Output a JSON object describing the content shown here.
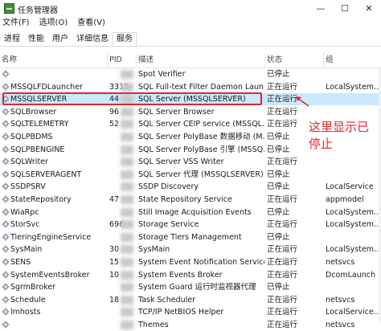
{
  "window": {
    "title": "任务管理器",
    "minimize_label": "—",
    "maximize_label": "☐",
    "close_label": "✕"
  },
  "menu": [
    "文件(F)",
    "选项(O)",
    "查看(V)"
  ],
  "tabs": [
    "进程",
    "性能",
    "用户",
    "详细信息",
    "服务"
  ],
  "active_tab_index": 4,
  "columns": {
    "name": "名称",
    "pid": "PID",
    "desc": "描述",
    "status": "状态",
    "group": "组"
  },
  "services": [
    {
      "name": "",
      "pid": "",
      "desc": "Spot Verifier",
      "status": "已停止",
      "group": ""
    },
    {
      "name": "MSSQLFDLauncher",
      "pid": "3312",
      "desc": "SQL Full-text Filter Daemon Laun...",
      "status": "正在运行",
      "group": "LocalSystem..."
    },
    {
      "name": "MSSQLSERVER",
      "pid": "44",
      "desc": "SQL Server (MSSQLSERVER)",
      "status": "正在运行",
      "group": ""
    },
    {
      "name": "SQLBrowser",
      "pid": "96",
      "desc": "SQL Server Browser",
      "status": "正在运行",
      "group": ""
    },
    {
      "name": "SQLTELEMETRY",
      "pid": "52",
      "desc": "SQL Server CEIP service (MSSQL...",
      "status": "正在运行",
      "group": ""
    },
    {
      "name": "SQLPBDMS",
      "pid": "",
      "desc": "SQL Server PolyBase 数据移动 (M...",
      "status": "已停止",
      "group": ""
    },
    {
      "name": "SQLPBENGINE",
      "pid": "",
      "desc": "SQL Server PolyBase 引擎 (MSSQ...",
      "status": "已停止",
      "group": ""
    },
    {
      "name": "SQLWriter",
      "pid": "",
      "desc": "SQL Server VSS Writer",
      "status": "正在运行",
      "group": ""
    },
    {
      "name": "SQLSERVERAGENT",
      "pid": "",
      "desc": "SQL Server 代理 (MSSQLSERVER)",
      "status": "已停止",
      "group": ""
    },
    {
      "name": "SSDPSRV",
      "pid": "",
      "desc": "SSDP Discovery",
      "status": "已停止",
      "group": "LocalService"
    },
    {
      "name": "StateRepository",
      "pid": "47",
      "desc": "State Repository Service",
      "status": "正在运行",
      "group": "appmodel"
    },
    {
      "name": "WiaRpc",
      "pid": "",
      "desc": "Still Image Acquisition Events",
      "status": "已停止",
      "group": "LocalSystem..."
    },
    {
      "name": "StorSvc",
      "pid": "696",
      "desc": "Storage Service",
      "status": "正在运行",
      "group": "LocalSystem..."
    },
    {
      "name": "TieringEngineService",
      "pid": "",
      "desc": "Storage Tiers Management",
      "status": "已停止",
      "group": ""
    },
    {
      "name": "SysMain",
      "pid": "30",
      "desc": "SysMain",
      "status": "正在运行",
      "group": "LocalSystem..."
    },
    {
      "name": "SENS",
      "pid": "15",
      "desc": "System Event Notification Service",
      "status": "正在运行",
      "group": "netsvcs"
    },
    {
      "name": "SystemEventsBroker",
      "pid": "10",
      "desc": "System Events Broker",
      "status": "正在运行",
      "group": "DcomLaunch"
    },
    {
      "name": "SgrmBroker",
      "pid": "",
      "desc": "System Guard 运行时监视器代理",
      "status": "已停止",
      "group": ""
    },
    {
      "name": "Schedule",
      "pid": "18",
      "desc": "Task Scheduler",
      "status": "正在运行",
      "group": "netsvcs"
    },
    {
      "name": "lmhosts",
      "pid": "",
      "desc": "TCP/IP NetBIOS Helper",
      "status": "正在运行",
      "group": "LocalService..."
    },
    {
      "name": "",
      "pid": "",
      "desc": "Themes",
      "status": "正在运行",
      "group": "netsvcs"
    }
  ],
  "selected_row_index": 2,
  "annotation": {
    "text": "这里显示已停止",
    "color": "#e0262f"
  },
  "colors": {
    "selection": "#cce8ff",
    "highlight": "#e0262f"
  }
}
